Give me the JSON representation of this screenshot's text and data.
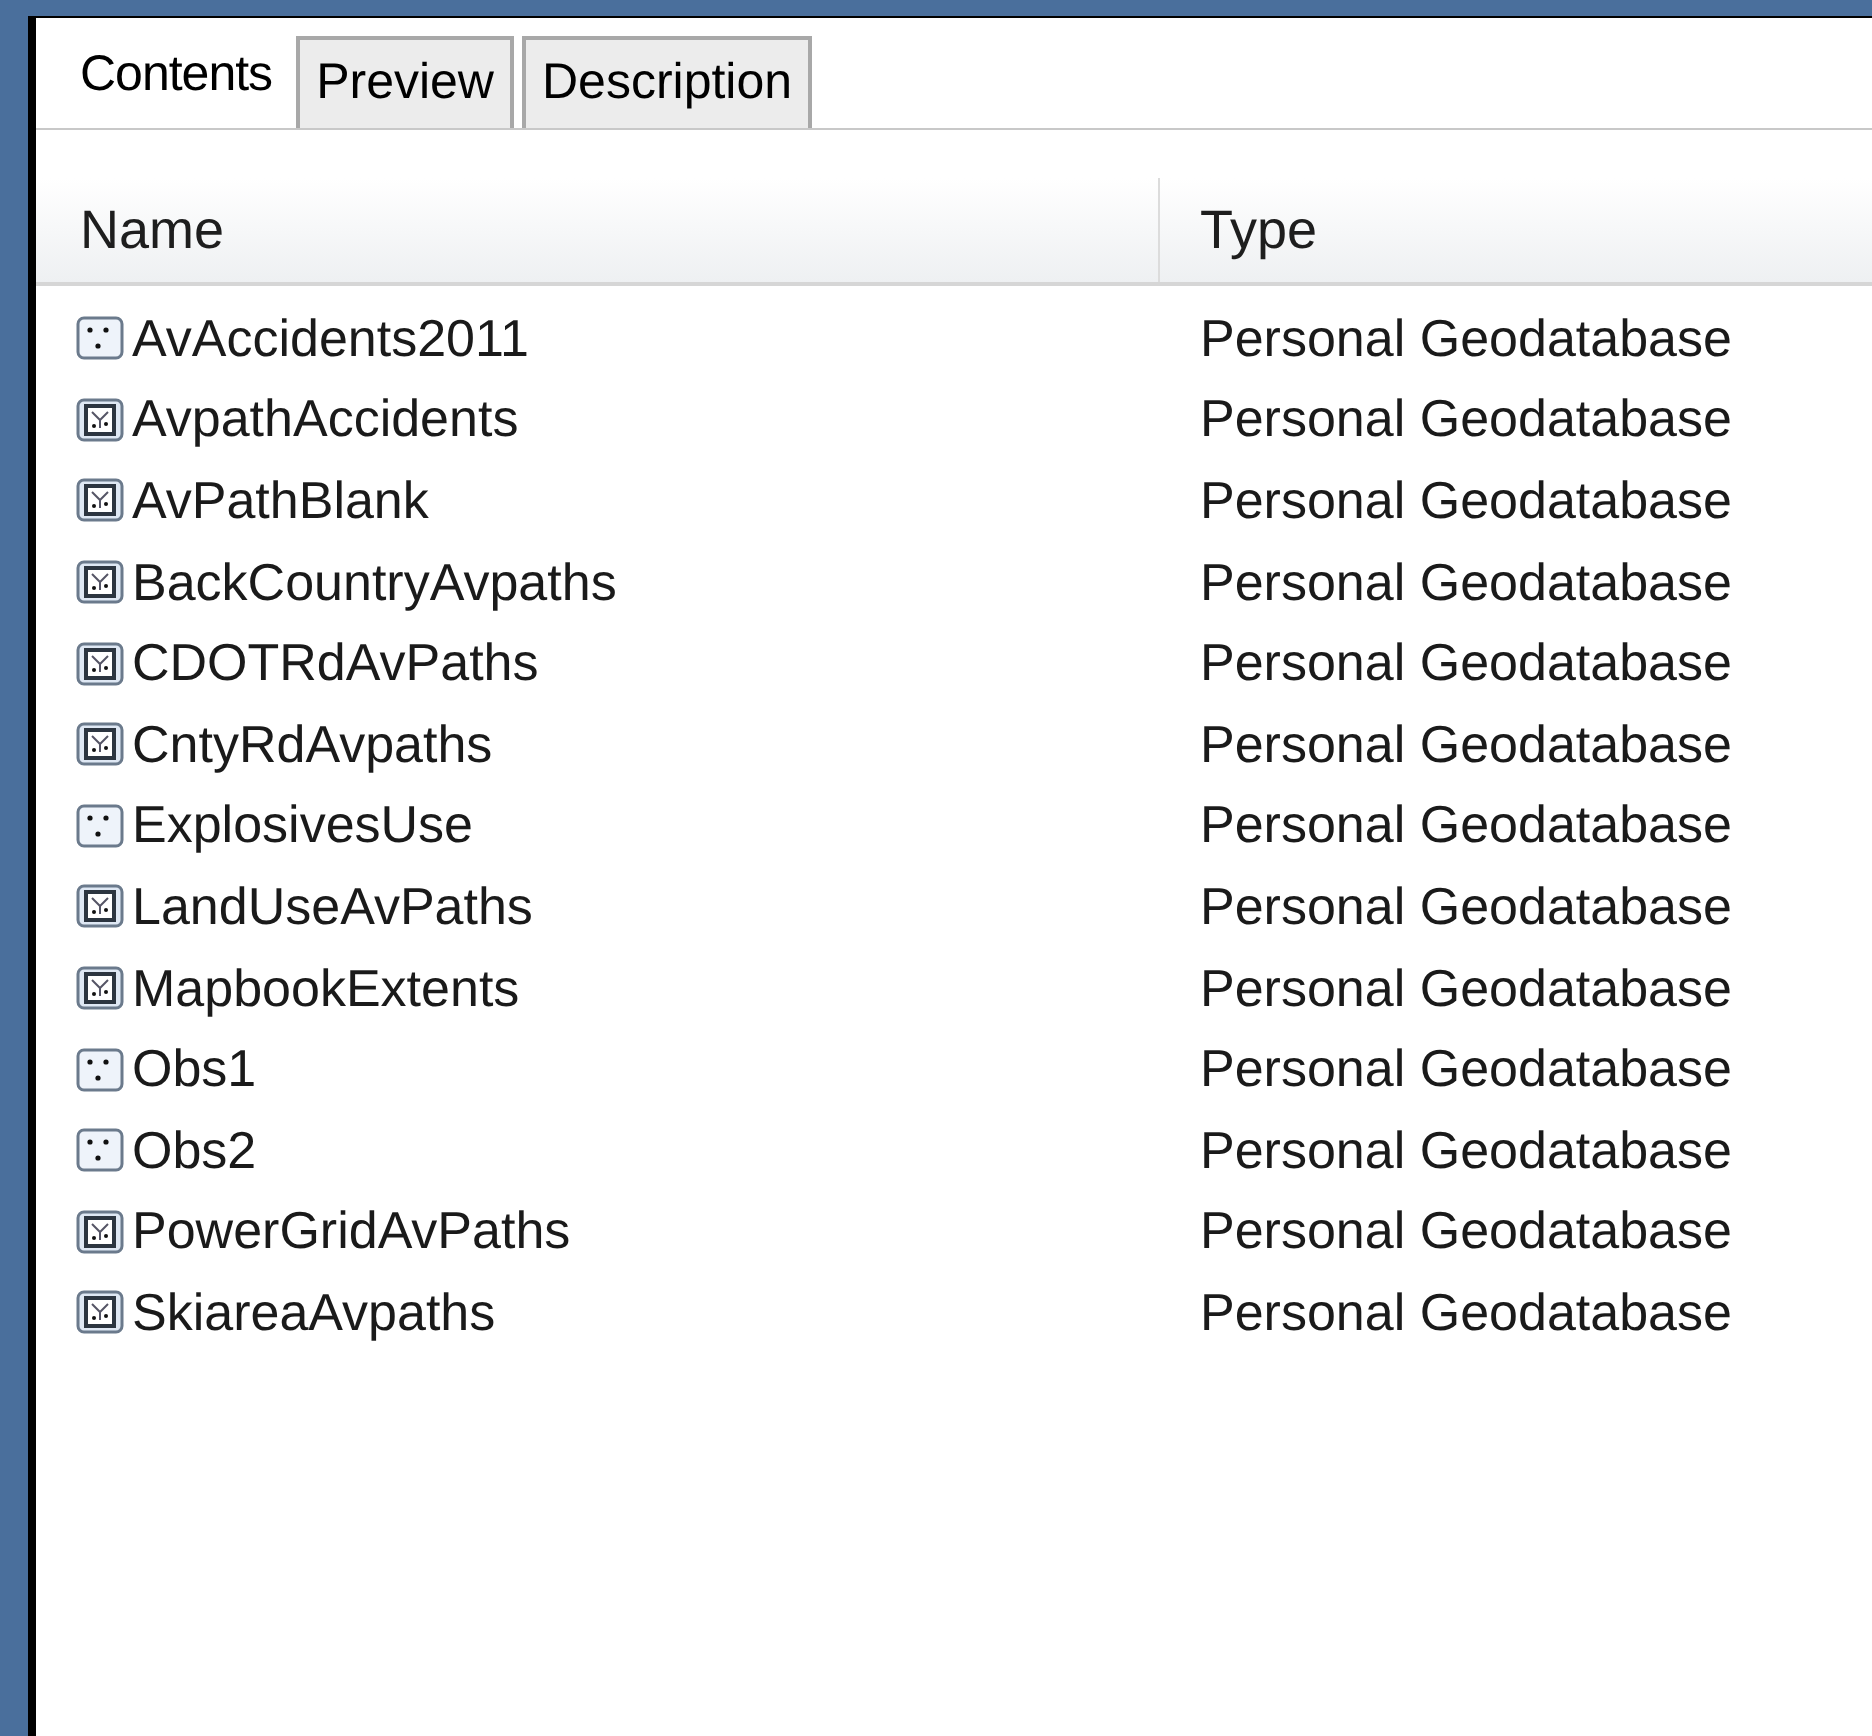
{
  "tabs": [
    {
      "label": "Contents",
      "selected": true
    },
    {
      "label": "Preview",
      "selected": false
    },
    {
      "label": "Description",
      "selected": false
    }
  ],
  "table": {
    "columns": [
      "Name",
      "Type"
    ],
    "rows": [
      {
        "kind": "point",
        "name": "AvAccidents2011",
        "type": "Personal Geodatabase"
      },
      {
        "kind": "polygon",
        "name": "AvpathAccidents",
        "type": "Personal Geodatabase"
      },
      {
        "kind": "polygon",
        "name": "AvPathBlank",
        "type": "Personal Geodatabase"
      },
      {
        "kind": "polygon",
        "name": "BackCountryAvpaths",
        "type": "Personal Geodatabase"
      },
      {
        "kind": "polygon",
        "name": "CDOTRdAvPaths",
        "type": "Personal Geodatabase"
      },
      {
        "kind": "polygon",
        "name": "CntyRdAvpaths",
        "type": "Personal Geodatabase"
      },
      {
        "kind": "point",
        "name": "ExplosivesUse",
        "type": "Personal Geodatabase"
      },
      {
        "kind": "polygon",
        "name": "LandUseAvPaths",
        "type": "Personal Geodatabase"
      },
      {
        "kind": "polygon",
        "name": "MapbookExtents",
        "type": "Personal Geodatabase"
      },
      {
        "kind": "point",
        "name": "Obs1",
        "type": "Personal Geodatabase"
      },
      {
        "kind": "point",
        "name": "Obs2",
        "type": "Personal Geodatabase"
      },
      {
        "kind": "polygon",
        "name": "PowerGridAvPaths",
        "type": "Personal Geodatabase"
      },
      {
        "kind": "polygon",
        "name": "SkiareaAvpaths",
        "type": "Personal Geodatabase"
      }
    ]
  }
}
